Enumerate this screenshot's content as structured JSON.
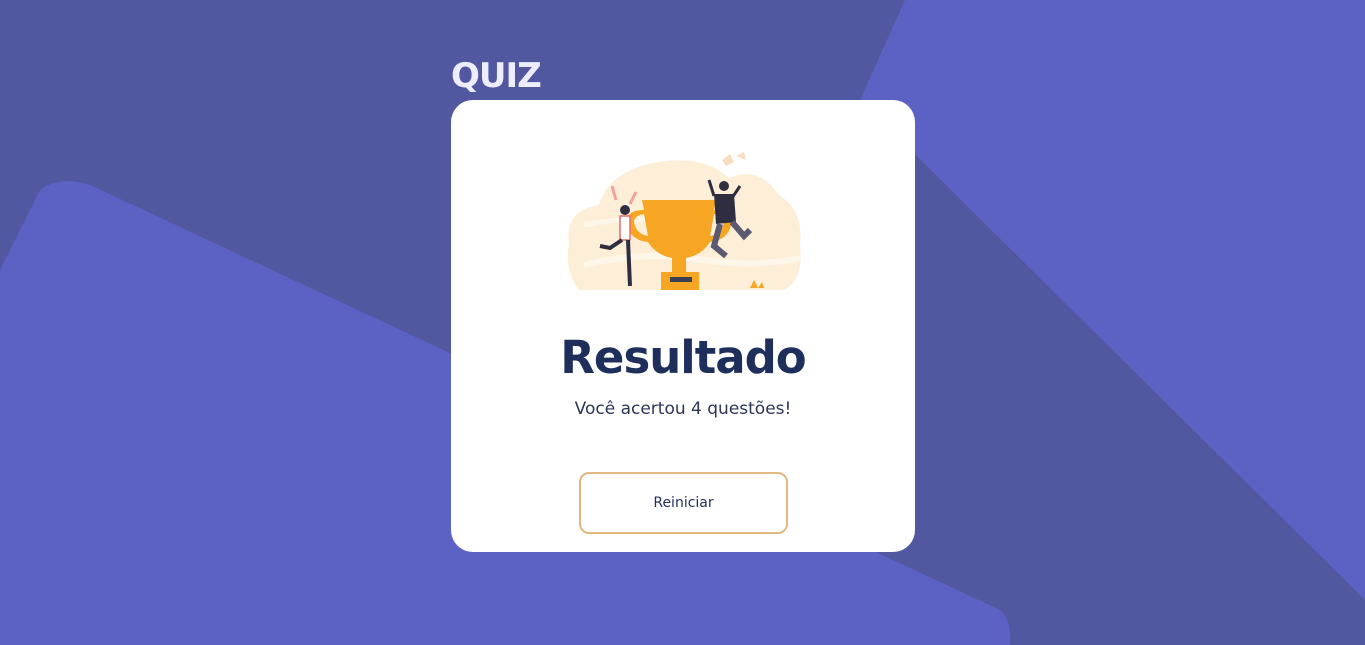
{
  "app": {
    "title": "QUIZ"
  },
  "result": {
    "heading": "Resultado",
    "message": "Você acertou 4 questões!",
    "restart_label": "Reiniciar"
  },
  "illustration": {
    "icon": "trophy-celebration-illustration"
  },
  "colors": {
    "background": "#5158a0",
    "background_shape": "#5b62c3",
    "card": "#ffffff",
    "heading": "#1f2f5c",
    "accent_border": "#e2b880",
    "trophy": "#f6a623"
  }
}
